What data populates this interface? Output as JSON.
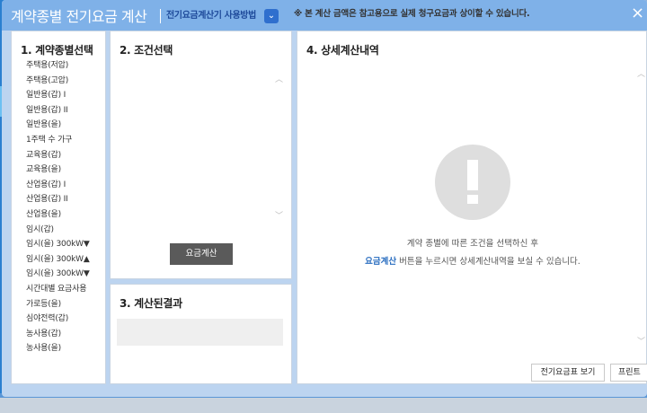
{
  "header": {
    "title": "계약종별 전기요금 계산",
    "help_link": "전기요금계산기 사용방법",
    "help_arrow": "⌄",
    "notice": "※ 본 계산 금액은 참고용으로 실제 청구요금과 상이할 수 있습니다.",
    "close": "×"
  },
  "panel1": {
    "title": "1. 계약종별선택",
    "items": [
      "주택용(저압)",
      "주택용(고압)",
      "일반용(갑) I",
      "일반용(갑) II",
      "일반용(을)",
      "1주택 수 가구",
      "교육용(갑)",
      "교육용(을)",
      "산업용(갑) I",
      "산업용(갑) II",
      "산업용(을)",
      "임시(갑)",
      "임시(을) 300kW▼",
      "임시(을) 300kW▲",
      "임시(을) 300kW▼",
      "시간대별 요금사용",
      "가로등(을)",
      "심야전력(갑)",
      "농사용(갑)",
      "농사용(을)"
    ]
  },
  "panel2": {
    "title": "2. 조건선택",
    "calc_button": "요금계산"
  },
  "panel3": {
    "title": "3. 계산된결과"
  },
  "panel4": {
    "title": "4. 상세계산내역",
    "message_line1": "계약 종별에 따른 조건을 선택하신 후",
    "message_highlight": "요금계산",
    "message_line2_rest": " 버튼을 누르시면 상세계산내역을 보실 수 있습니다.",
    "rate_table_button": "전기요금표 보기",
    "print_button": "프린트"
  },
  "icons": {
    "alert": "exclamation-icon",
    "scroll_up": "chevron-up-icon",
    "scroll_down": "chevron-down-icon"
  },
  "colors": {
    "header_bg": "#7fb1e8",
    "accent_blue": "#2a6ec0",
    "button_dark": "#5a5a5a"
  }
}
